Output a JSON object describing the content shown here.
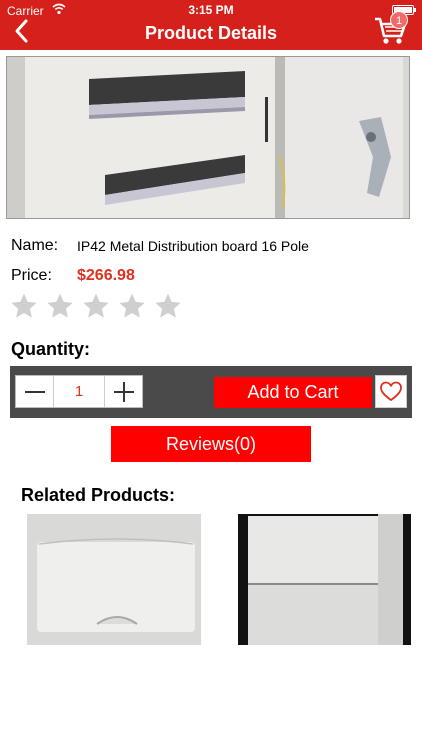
{
  "status": {
    "carrier": "Carrier",
    "time": "3:15 PM"
  },
  "nav": {
    "title": "Product Details",
    "cart_count": "1"
  },
  "product": {
    "name_label": "Name:",
    "name": "IP42 Metal Distribution board 16 Pole",
    "price_label": "Price:",
    "price": "$266.98",
    "rating": 0,
    "rating_max": 5
  },
  "quantity": {
    "label": "Quantity:",
    "value": "1"
  },
  "actions": {
    "add_to_cart": "Add to Cart",
    "reviews": "Reviews(0)"
  },
  "related": {
    "title": "Related Products:"
  },
  "colors": {
    "accent": "#d6201b",
    "button": "#ff0000",
    "price": "#e0301e",
    "bar": "#4a4a4a"
  },
  "icons": [
    "back-chevron-icon",
    "cart-icon",
    "wifi-icon",
    "star-icon",
    "minus-icon",
    "plus-icon",
    "heart-icon"
  ]
}
